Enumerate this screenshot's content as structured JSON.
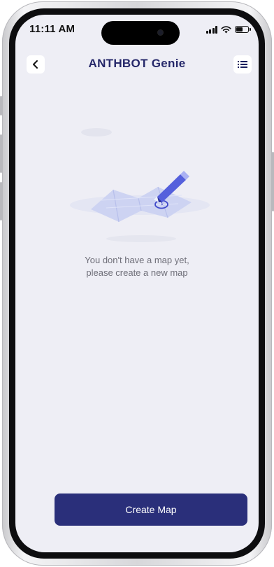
{
  "status_bar": {
    "time": "11:11 AM",
    "icons": [
      "cellular-signal-icon",
      "wifi-icon",
      "battery-icon"
    ]
  },
  "header": {
    "title": "ANTHBOT Genie",
    "back_icon": "chevron-left-icon",
    "menu_icon": "list-menu-icon"
  },
  "empty_state": {
    "illustration": "map-with-pencil-illustration",
    "line1": "You don't have a map yet,",
    "line2": "please create a new map"
  },
  "actions": {
    "create_map_label": "Create Map"
  },
  "colors": {
    "primary": "#2a2f7a",
    "title": "#26286a",
    "background": "#eeeef5",
    "muted_text": "#6e6e78"
  }
}
